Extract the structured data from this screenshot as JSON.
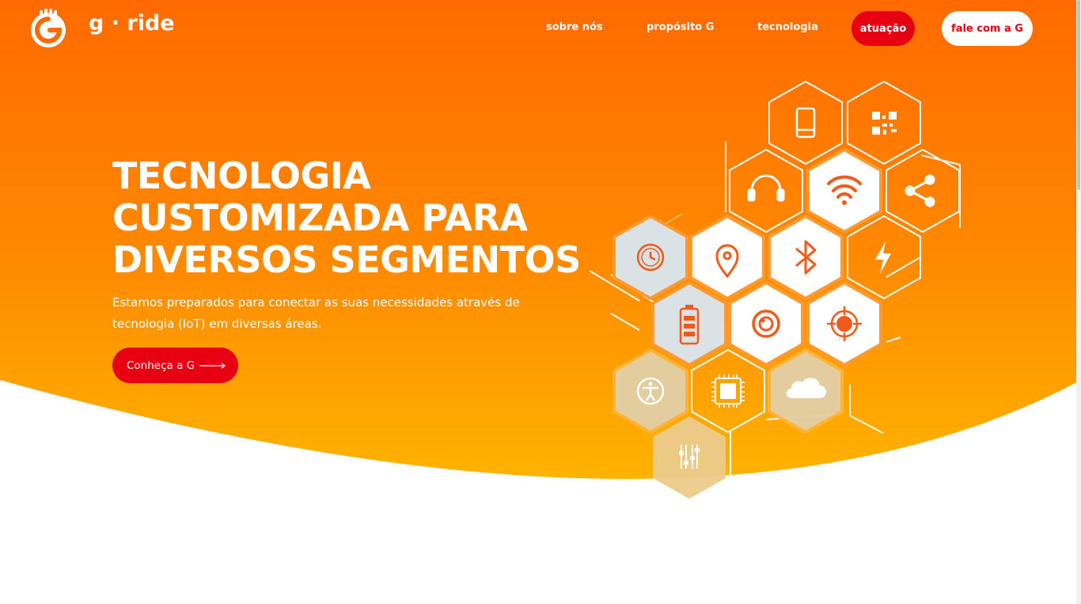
{
  "brand": {
    "name": "g · ride",
    "logo_icon": "g-logo-icon"
  },
  "nav": {
    "items": [
      {
        "label": "sobre nós"
      },
      {
        "label": "propósito G"
      },
      {
        "label": "tecnologia"
      }
    ],
    "active_label": "atuação",
    "contact_label": "fale com a G"
  },
  "hero": {
    "title_lines": [
      "TECNOLOGIA",
      "CUSTOMIZADA PARA",
      "DIVERSOS SEGMENTOS"
    ],
    "subtitle": "Estamos preparados para conectar as suas necessidades através de tecnologia (IoT) em diversas áreas.",
    "cta_label": "Conheça a G",
    "cta_icon": "arrow-right-icon"
  },
  "honeycomb": {
    "icons": [
      "smartphone-icon",
      "qr-code-icon",
      "headphones-icon",
      "wifi-icon",
      "share-icon",
      "clock-icon",
      "location-pin-icon",
      "bluetooth-icon",
      "lightning-icon",
      "battery-icon",
      "camera-lens-icon",
      "target-icon",
      "accessibility-icon",
      "chip-icon",
      "cloud-icon",
      "sliders-icon"
    ]
  },
  "colors": {
    "orange_top": "#ff6a00",
    "orange_bottom": "#ffb300",
    "accent_red": "#e60012",
    "icon_orange": "#f05a1a"
  }
}
